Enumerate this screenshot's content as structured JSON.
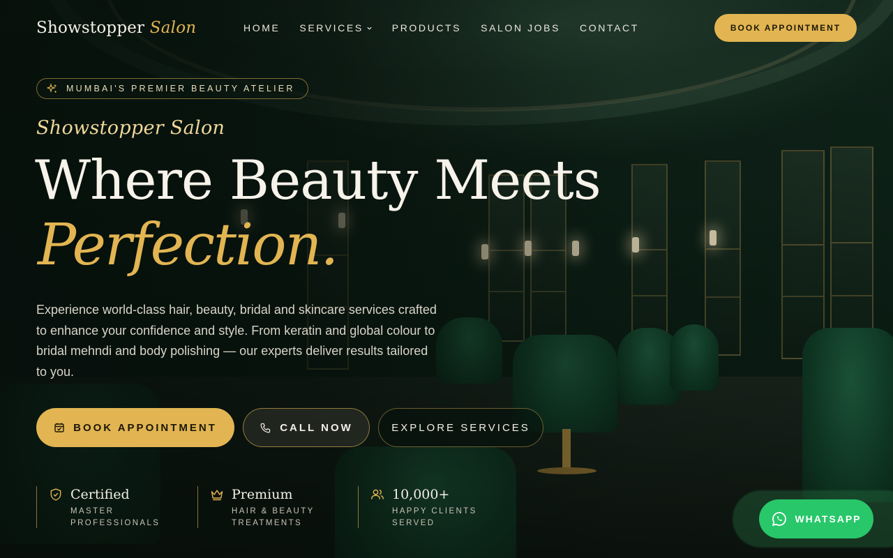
{
  "brand": {
    "name": "Showstopper",
    "accent": "Salon"
  },
  "nav": {
    "items": [
      {
        "label": "HOME"
      },
      {
        "label": "SERVICES"
      },
      {
        "label": "PRODUCTS"
      },
      {
        "label": "SALON JOBS"
      },
      {
        "label": "CONTACT"
      }
    ],
    "cta": "BOOK APPOINTMENT"
  },
  "hero": {
    "badge": "MUMBAI'S PREMIER BEAUTY ATELIER",
    "tagline": "Showstopper Salon",
    "headline": "Where Beauty Meets",
    "headline_accent": "Perfection.",
    "description": "Experience world-class hair, beauty, bridal and skincare services crafted to enhance your confidence and style. From keratin and global colour to bridal mehndi and body polishing — our experts deliver results tailored to you.",
    "buttons": {
      "book": "BOOK APPOINTMENT",
      "call": "CALL NOW",
      "explore": "EXPLORE SERVICES"
    }
  },
  "stats": [
    {
      "icon": "shield-check-icon",
      "title": "Certified",
      "line1": "MASTER",
      "line2": "PROFESSIONALS"
    },
    {
      "icon": "crown-icon",
      "title": "Premium",
      "line1": "HAIR & BEAUTY",
      "line2": "TREATMENTS"
    },
    {
      "icon": "users-icon",
      "title": "10,000+",
      "line1": "HAPPY CLIENTS",
      "line2": "SERVED"
    }
  ],
  "whatsapp": {
    "label": "WHATSAPP"
  },
  "colors": {
    "accent_gold": "#e2b552",
    "background_green": "#0b1a12",
    "whatsapp_green": "#28c76a"
  }
}
